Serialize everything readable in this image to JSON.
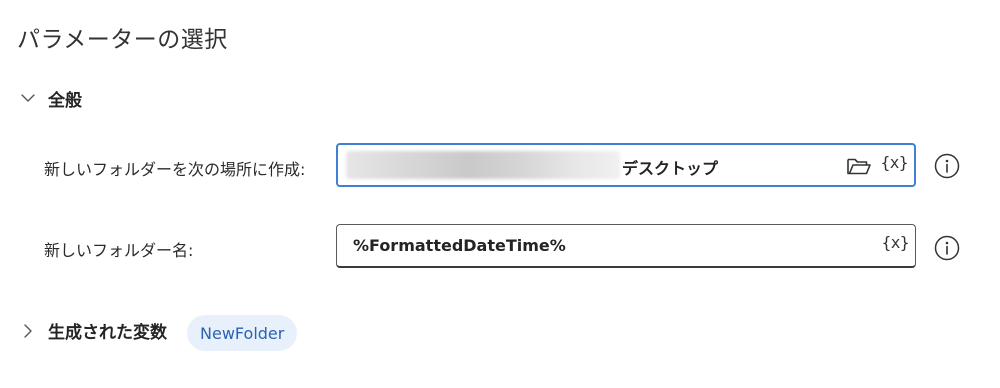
{
  "page": {
    "title": "パラメーターの選択"
  },
  "general": {
    "label": "全般",
    "expanded": true
  },
  "fields": [
    {
      "label": "新しいフォルダーを次の場所に作成:",
      "value": "デスクトップ",
      "value_prefix_obscured": true,
      "icons": [
        "folder-icon",
        "variable-icon"
      ],
      "focused": true
    },
    {
      "label": "新しいフォルダー名:",
      "value": "%FormattedDateTime%",
      "icons": [
        "variable-icon"
      ],
      "focused": false
    }
  ],
  "icons": {
    "variable_glyph": "{x}"
  },
  "produced_variables": {
    "label": "生成された変数",
    "expanded": false,
    "items": [
      "NewFolder"
    ]
  },
  "colors": {
    "focus_border": "#3f7fd4",
    "chip_bg": "#e8f1fb",
    "chip_text": "#2a62b5"
  }
}
